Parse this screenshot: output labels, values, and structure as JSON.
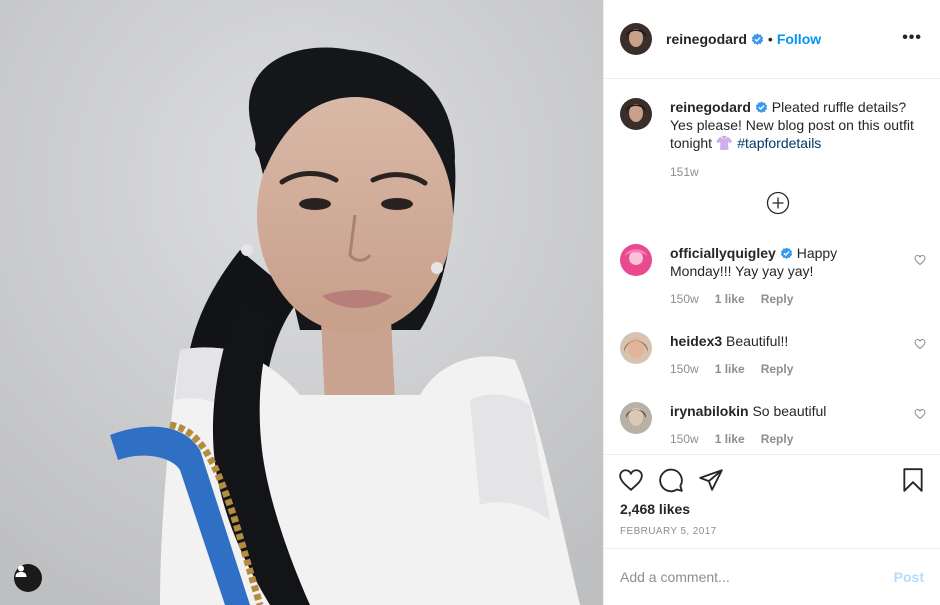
{
  "post": {
    "username": "reinegodard",
    "separator": "•",
    "follow_label": "Follow",
    "more_label": "•••",
    "caption_text": "Pleated ruffle details? Yes please! New blog post on this outfit tonight 👚",
    "caption_hashtag": "#tapfordetails",
    "caption_time": "151w",
    "likes": "2,468 likes",
    "date": "FEBRUARY 5, 2017"
  },
  "comments": [
    {
      "username": "officiallyquigley",
      "verified": true,
      "text": "Happy Monday!!! Yay yay yay!",
      "time": "150w",
      "likes": "1 like",
      "reply": "Reply",
      "avatar_color": "#e8498f"
    },
    {
      "username": "heidex3",
      "verified": false,
      "text": "Beautiful!!",
      "time": "150w",
      "likes": "1 like",
      "reply": "Reply",
      "avatar_color": "#b88a6a"
    },
    {
      "username": "irynabilokin",
      "verified": false,
      "text": "So beautiful",
      "time": "150w",
      "likes": "1 like",
      "reply": "Reply",
      "avatar_color": "#8d8678"
    }
  ],
  "add_comment": {
    "placeholder": "Add a comment...",
    "post_label": "Post"
  },
  "icons": {
    "verified": "verified-badge-icon",
    "load_more": "plus-circle-icon",
    "like": "heart-icon",
    "comment": "comment-icon",
    "share": "paper-plane-icon",
    "save": "bookmark-icon",
    "tag": "user-tag-icon"
  },
  "colors": {
    "accent": "#0095f6",
    "hashtag": "#00376b",
    "muted": "#8e8e8e",
    "post_disabled": "#b3dbff"
  }
}
